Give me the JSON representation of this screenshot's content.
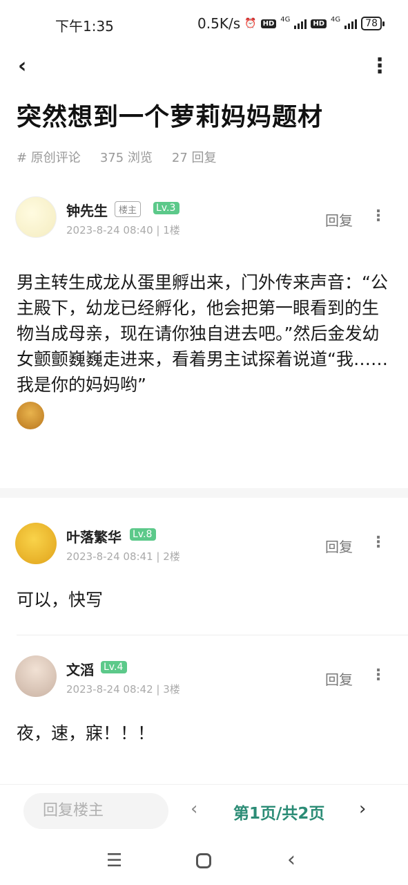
{
  "status_bar": {
    "time": "下午1:35",
    "speed": "0.5K/s",
    "alarm_icon": "alarm-icon",
    "hd1": "HD",
    "net1": "4G",
    "hd2": "HD",
    "net2": "4G",
    "battery": "78"
  },
  "nav": {
    "back_icon": "back-arrow-icon",
    "more_icon": "more-vertical-icon"
  },
  "post": {
    "title": "突然想到一个萝莉妈妈题材",
    "category": "# 原创评论",
    "views": "375 浏览",
    "replies": "27 回复"
  },
  "comments": [
    {
      "username": "钟先生",
      "owner_badge": "楼主",
      "level": "Lv.3",
      "timestamp": "2023-8-24 08:40",
      "floor": "1楼",
      "reply_label": "回复",
      "body": "男主转生成龙从蛋里孵出来，门外传来声音：“公主殿下，幼龙已经孵化，他会把第一眼看到的生物当成母亲，现在请你独自进去吧。”然后金发幼女颤颤巍巍走进来，看着男主试探着说道“我……我是你的妈妈哟”",
      "emoji": "monkey-emoji"
    },
    {
      "username": "叶落繁华",
      "level": "Lv.8",
      "timestamp": "2023-8-24 08:41",
      "floor": "2楼",
      "reply_label": "回复",
      "body": "可以，快写"
    },
    {
      "username": "文滔",
      "level": "Lv.4",
      "timestamp": "2023-8-24 08:42",
      "floor": "3楼",
      "reply_label": "回复",
      "body": "夜，速，寐！！！"
    }
  ],
  "bottom_bar": {
    "reply_placeholder": "回复楼主",
    "page_indicator": "第1页/共2页"
  },
  "colors": {
    "level_badge": "#5cc98a",
    "page_indicator": "#2c8c76"
  }
}
